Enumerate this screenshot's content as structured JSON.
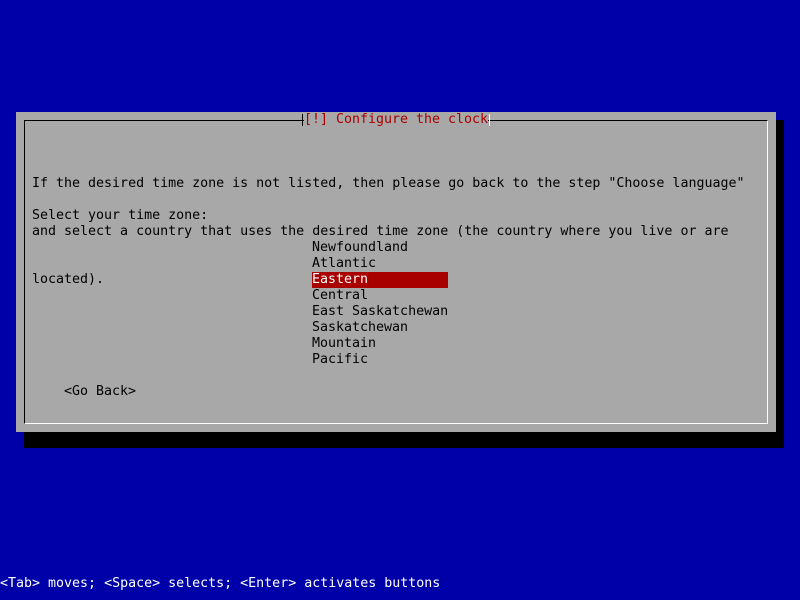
{
  "dialog": {
    "title": "[!] Configure the clock",
    "description_lines": [
      "If the desired time zone is not listed, then please go back to the step \"Choose language\"",
      "and select a country that uses the desired time zone (the country where you live or are",
      "located)."
    ],
    "prompt": "Select your time zone:",
    "timezones": [
      "Newfoundland",
      "Atlantic",
      "Eastern",
      "Central",
      "East Saskatchewan",
      "Saskatchewan",
      "Mountain",
      "Pacific"
    ],
    "selected_timezone": "Eastern",
    "go_back_label": "<Go Back>"
  },
  "statusbar": {
    "hint": "<Tab> moves; <Space> selects; <Enter> activates buttons"
  },
  "colors": {
    "background": "#0000a8",
    "dialog": "#a8a8a8",
    "highlight": "#a80000",
    "title_text": "#a80000"
  }
}
